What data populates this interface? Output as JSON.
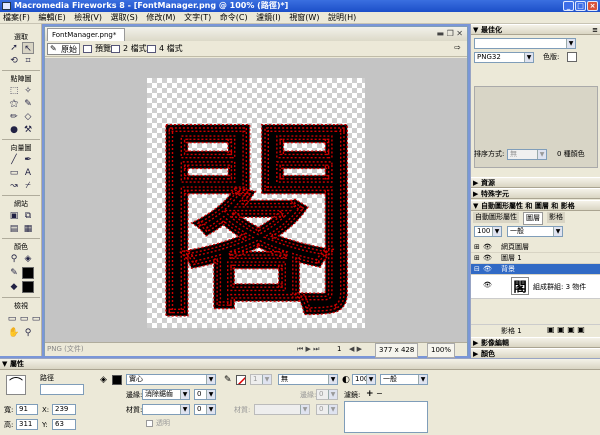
{
  "window": {
    "title": "Macromedia Fireworks 8 - [FontManager.png @ 100% (路徑)*]",
    "minimize": "_",
    "maximize": "□",
    "close": "×"
  },
  "menubar": [
    "檔案(F)",
    "編輯(E)",
    "檢視(V)",
    "選取(S)",
    "修改(M)",
    "文字(T)",
    "命令(C)",
    "濾鏡(I)",
    "視窗(W)",
    "說明(H)"
  ],
  "tools": {
    "sections": [
      "選取",
      "點陣圖",
      "向量圖",
      "網站",
      "顏色",
      "檢視"
    ]
  },
  "document": {
    "tab": "FontManager.png*",
    "view_tabs": [
      "原始",
      "預覽",
      "2 檔式",
      "4 檔式"
    ],
    "glyph": "閣",
    "status_left": "PNG (文件)",
    "page": "1",
    "size": "377 x 428",
    "zoom": "100%"
  },
  "optimize": {
    "header": "最佳化",
    "format": "PNG32",
    "matte_label": "色版:",
    "sort_label": "排序方式:",
    "sort_value": "無",
    "colors": "0 種顏色"
  },
  "panels": {
    "assets": "資源",
    "special": "特殊字元",
    "layers_header": "自動圖形屬性 和 圖層 和 影格",
    "tabs": [
      "自動圖形屬性",
      "圖層",
      "影格"
    ],
    "opacity": "100",
    "blend": "一般",
    "layers": [
      {
        "name": "網頁圖層"
      },
      {
        "name": "圖層 1"
      },
      {
        "name": "背景"
      }
    ],
    "object": "組成群組: 3 物件",
    "frame": "影格 1",
    "collapsed": [
      "影像編輯",
      "顏色"
    ]
  },
  "properties": {
    "header": "屬性",
    "object_name": "路徑",
    "w_label": "寬:",
    "w": "91",
    "h_label": "高:",
    "h": "311",
    "x_label": "X:",
    "x": "239",
    "y_label": "Y:",
    "y": "63",
    "fill_type": "實心",
    "edge_label": "邊緣:",
    "edge": "消除鋸齒",
    "edge_amount": "0",
    "texture_label": "材質:",
    "texture_amount": "0",
    "transparent": "透明",
    "stroke_type": "無",
    "stroke_size": "1",
    "stroke_edge_label": "邊緣:",
    "stroke_edge": "0",
    "stroke_texture_label": "材質:",
    "stroke_texture_amount": "0",
    "opacity": "100",
    "blend": "一般",
    "filters_label": "濾鏡:"
  }
}
